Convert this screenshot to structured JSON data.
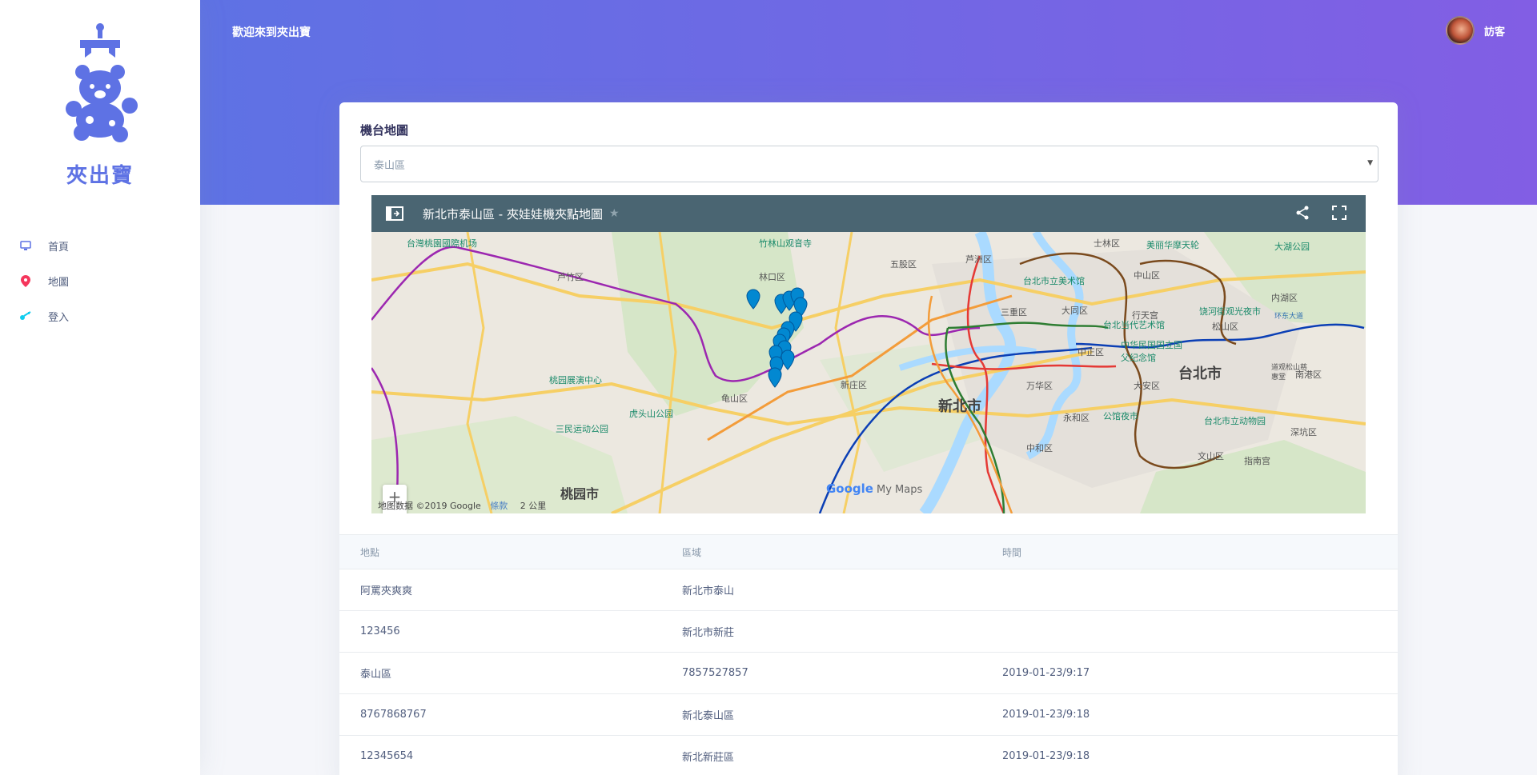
{
  "brand": {
    "name": "夾出寶",
    "logo_icon": "claw-machine-bear-icon"
  },
  "sidebar": {
    "items": [
      {
        "label": "首頁",
        "icon": "monitor-icon",
        "color": "#5e72e4"
      },
      {
        "label": "地圖",
        "icon": "map-pin-icon",
        "color": "#f5365c"
      },
      {
        "label": "登入",
        "icon": "key-icon",
        "color": "#11cdef"
      }
    ]
  },
  "header": {
    "welcome": "歡迎來到夾出寶",
    "user_name": "訪客"
  },
  "card": {
    "title": "機台地圖",
    "select": {
      "value": "泰山區"
    }
  },
  "map": {
    "title": "新北市泰山區 - 夾娃娃機夾點地圖",
    "labels": [
      "台灣桃園國際机场",
      "竹林山观音寺",
      "五股区",
      "芦洲区",
      "士林区",
      "美丽华摩天轮",
      "大湖公园",
      "芦竹区",
      "林口区",
      "台北市立美术馆",
      "中山区",
      "内湖区",
      "三重区",
      "大同区",
      "行天宫",
      "饶河街观光夜市",
      "台北当代艺术馆",
      "松山区",
      "中华民国国立国父纪念馆",
      "中正区",
      "台北市",
      "南港区",
      "桃园展演中心",
      "新庄区",
      "新北市",
      "万华区",
      "大安区",
      "龟山区",
      "虎头山公园",
      "三民运动公园",
      "永和区",
      "公馆夜市",
      "台北市立动物园",
      "深坑区",
      "中和区",
      "文山区",
      "指南宫",
      "桃园市",
      "环东大道",
      "道观松山慈惠堂"
    ],
    "footer": {
      "data": "地图数据 ©2019 Google",
      "terms": "條款",
      "scale": "2 公里"
    },
    "google": "Google",
    "mymaps": "My Maps"
  },
  "table": {
    "headers": [
      "地點",
      "區域",
      "時間"
    ],
    "rows": [
      {
        "place": "阿罵夾爽爽",
        "area": "新北市泰山",
        "time": ""
      },
      {
        "place": "123456",
        "area": "新北市新莊",
        "time": ""
      },
      {
        "place": "泰山區",
        "area": "7857527857",
        "time": "2019-01-23/9:17"
      },
      {
        "place": "8767868767",
        "area": "新北泰山區",
        "time": "2019-01-23/9:18"
      },
      {
        "place": "12345654",
        "area": "新北新莊區",
        "time": "2019-01-23/9:18"
      }
    ]
  }
}
